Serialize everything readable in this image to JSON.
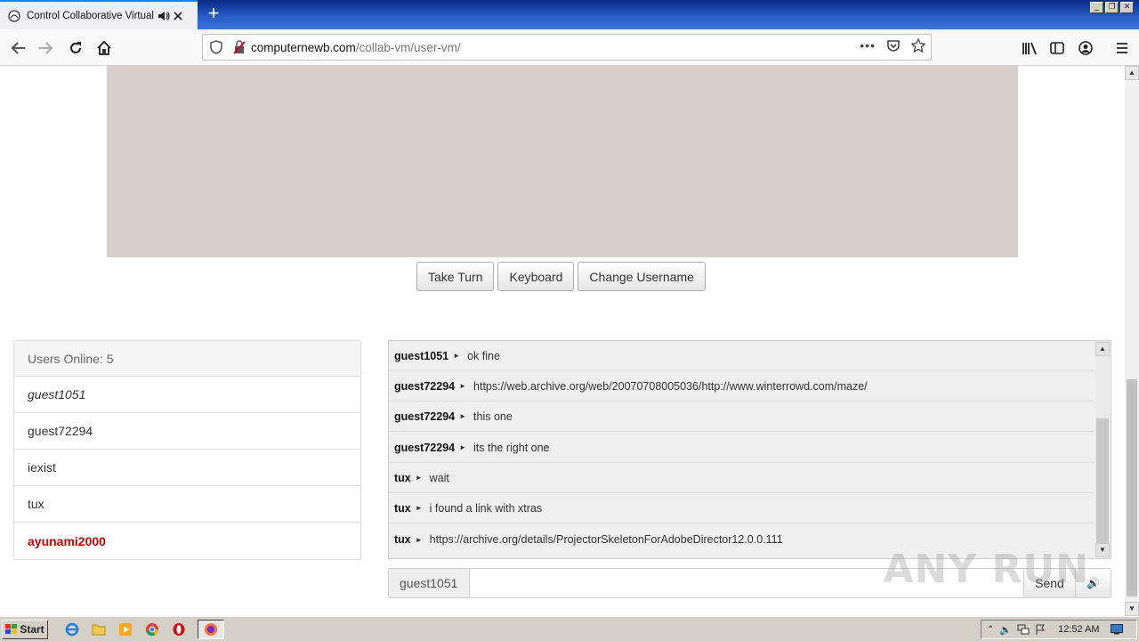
{
  "browser": {
    "tab_title": "Control Collaborative Virtual M",
    "url_host": "computernewb.com",
    "url_path": "/collab-vm/user-vm/"
  },
  "controls": {
    "take_turn": "Take Turn",
    "keyboard": "Keyboard",
    "change_username": "Change Username"
  },
  "users": {
    "header": "Users Online: 5",
    "list": [
      "guest1051",
      "guest72294",
      "iexist",
      "tux",
      "ayunami2000"
    ]
  },
  "chat": {
    "messages": [
      {
        "user": "guest1051",
        "text": "ok fine"
      },
      {
        "user": "guest72294",
        "text": "https://web.archive.org/web/20070708005036/http://www.winterrowd.com/maze/"
      },
      {
        "user": "guest72294",
        "text": "this one"
      },
      {
        "user": "guest72294",
        "text": "its the right one"
      },
      {
        "user": "tux",
        "text": "wait"
      },
      {
        "user": "tux",
        "text": "i found a link with xtras"
      },
      {
        "user": "tux",
        "text": "https://archive.org/details/ProjectorSkeletonForAdobeDirector12.0.0.111"
      }
    ],
    "username": "guest1051",
    "send_label": "Send"
  },
  "watermark": "ANY RUN",
  "taskbar": {
    "start_label": "Start",
    "clock": "12:52 AM"
  }
}
